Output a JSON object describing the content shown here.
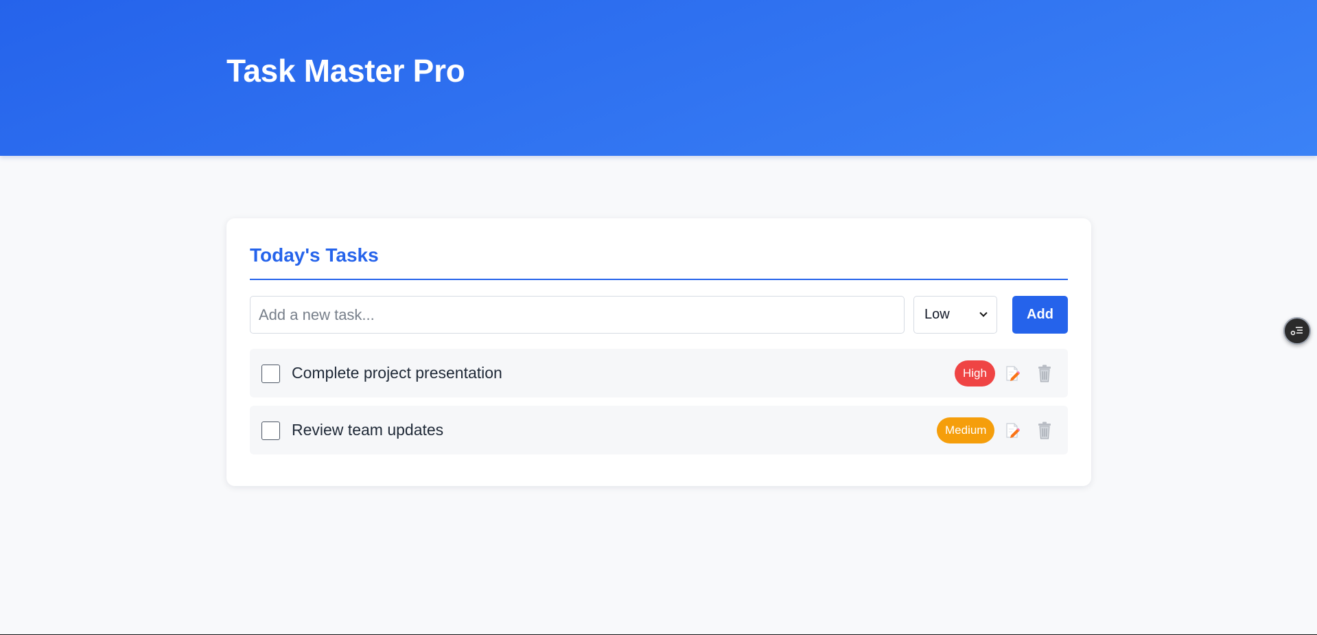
{
  "app": {
    "title": "Task Master Pro"
  },
  "tasks_panel": {
    "title": "Today's Tasks",
    "new_task_input": {
      "placeholder": "Add a new task...",
      "value": ""
    },
    "priority_select": {
      "selected": "Low"
    },
    "add_button_label": "Add"
  },
  "tasks": [
    {
      "text": "Complete project presentation",
      "completed": false,
      "priority": "High",
      "priority_color": "#ef4444"
    },
    {
      "text": "Review team updates",
      "completed": false,
      "priority": "Medium",
      "priority_color": "#f59e0b"
    }
  ],
  "icons": {
    "edit": "edit-icon",
    "delete": "trash-icon",
    "floating": "settings-list-icon"
  },
  "colors": {
    "accent": "#2563eb",
    "header_gradient_start": "#2563eb",
    "header_gradient_end": "#3b82f6",
    "page_background": "#f8f9fb"
  }
}
